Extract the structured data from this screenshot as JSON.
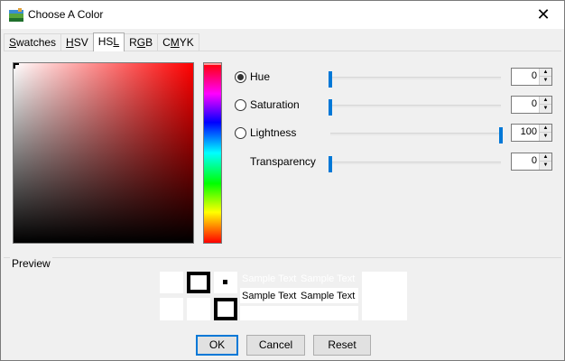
{
  "window": {
    "title": "Choose A Color",
    "close_glyph": "✕"
  },
  "tabs": [
    {
      "pre": "",
      "key": "S",
      "post": "watches",
      "active": false
    },
    {
      "pre": "",
      "key": "H",
      "post": "SV",
      "active": false
    },
    {
      "pre": "HS",
      "key": "L",
      "post": "",
      "active": true
    },
    {
      "pre": "R",
      "key": "G",
      "post": "B",
      "active": false
    },
    {
      "pre": "C",
      "key": "M",
      "post": "YK",
      "active": false
    }
  ],
  "controls": {
    "hue": {
      "label": "Hue",
      "value": "0",
      "checked": true,
      "fraction": 0
    },
    "saturation": {
      "label": "Saturation",
      "value": "0",
      "checked": false,
      "fraction": 0
    },
    "lightness": {
      "label": "Lightness",
      "value": "100",
      "checked": false,
      "fraction": 1
    },
    "transparency": {
      "label": "Transparency",
      "value": "0",
      "fraction": 0
    }
  },
  "preview": {
    "label": "Preview",
    "sample_text": "Sample Text"
  },
  "buttons": {
    "ok": "OK",
    "cancel": "Cancel",
    "reset": "Reset"
  },
  "colors": {
    "accent": "#0078d7",
    "selected_hue": "#ff0000"
  }
}
